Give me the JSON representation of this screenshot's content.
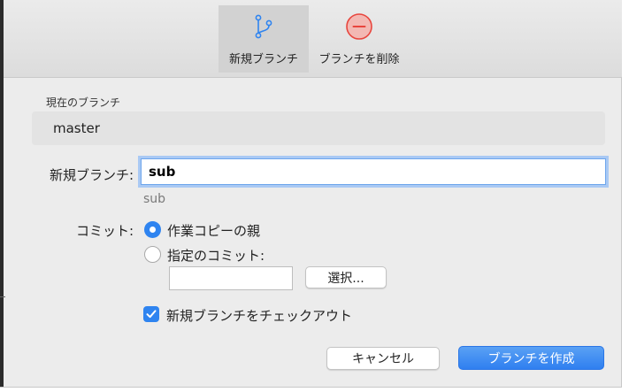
{
  "toolbar": {
    "new_branch_label": "新規ブランチ",
    "delete_branch_label": "ブランチを削除"
  },
  "current_branch": {
    "label": "現在のブランチ",
    "value": "master"
  },
  "new_branch": {
    "label": "新規ブランチ:",
    "value": "sub",
    "preview": "sub"
  },
  "commit": {
    "label": "コミット:",
    "option_parent": "作業コピーの親",
    "option_specified": "指定のコミット:",
    "selected": "作業コピーの親",
    "commit_value": "",
    "select_button": "選択..."
  },
  "checkout": {
    "label": "新規ブランチをチェックアウト",
    "checked": true
  },
  "buttons": {
    "cancel": "キャンセル",
    "create": "ブランチを作成"
  },
  "colors": {
    "accent": "#2f84f0",
    "delete_icon": "#e8463e"
  }
}
